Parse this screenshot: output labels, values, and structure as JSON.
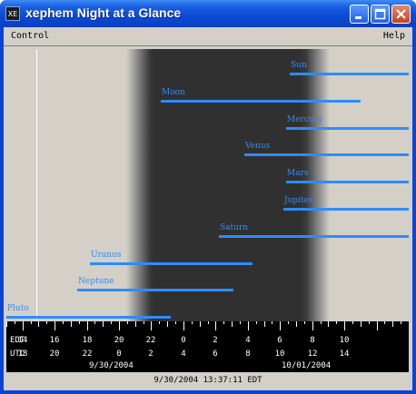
{
  "window": {
    "title": "xephem Night at a Glance",
    "icon_text": "XE"
  },
  "menubar": {
    "control": "Control",
    "help": "Help"
  },
  "planets": [
    {
      "name": "Sun",
      "start_hour": 30.6,
      "end_hour": 38.0
    },
    {
      "name": "Moon",
      "start_hour": 22.6,
      "end_hour": 35.0
    },
    {
      "name": "Mercury",
      "start_hour": 30.4,
      "end_hour": 38.0
    },
    {
      "name": "Venus",
      "start_hour": 27.8,
      "end_hour": 38.0
    },
    {
      "name": "Mars",
      "start_hour": 30.4,
      "end_hour": 38.0
    },
    {
      "name": "Jupiter",
      "start_hour": 30.2,
      "end_hour": 38.0
    },
    {
      "name": "Saturn",
      "start_hour": 26.2,
      "end_hour": 38.0
    },
    {
      "name": "Uranus",
      "start_hour": 18.2,
      "end_hour": 28.3
    },
    {
      "name": "Neptune",
      "start_hour": 17.4,
      "end_hour": 27.1
    },
    {
      "name": "Pluto",
      "start_hour": 13.0,
      "end_hour": 23.2
    }
  ],
  "scale": {
    "edt_label": "EDT",
    "utc_label": "UTC",
    "edt_ticks": [
      "14",
      "16",
      "18",
      "20",
      "22",
      "0",
      "2",
      "4",
      "6",
      "8",
      "10"
    ],
    "utc_ticks": [
      "18",
      "20",
      "22",
      "0",
      "2",
      "4",
      "6",
      "8",
      "10",
      "12",
      "14"
    ],
    "date_left": "9/30/2004",
    "date_right": "10/01/2004"
  },
  "status": {
    "datetime": "9/30/2004 13:37:11 EDT"
  },
  "colors": {
    "bar": "#2c8cff",
    "night": "#303030",
    "background": "#d4d0c8"
  }
}
